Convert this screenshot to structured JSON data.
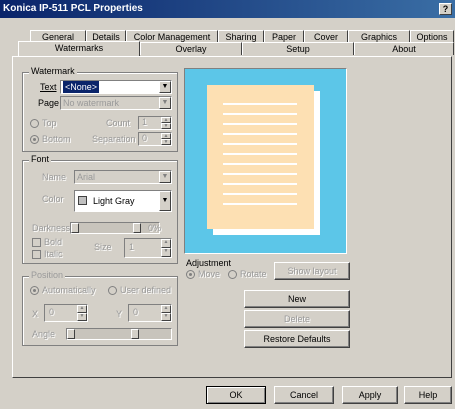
{
  "window": {
    "title": "Konica IP-511 PCL Properties",
    "help_button": "?"
  },
  "tabs_row1": [
    "General",
    "Details",
    "Color Management",
    "Sharing",
    "Paper",
    "Cover",
    "Graphics",
    "Options"
  ],
  "tabs_row2": [
    "Watermarks",
    "Overlay",
    "Setup",
    "About"
  ],
  "watermark": {
    "group_label": "Watermark",
    "text_label": "Text",
    "text_value": "<None>",
    "page_label": "Page",
    "page_value": "No watermark",
    "top_label": "Top",
    "bottom_label": "Bottom",
    "count_label": "Count",
    "count_value": "1",
    "separation_label": "Separation",
    "separation_value": "0"
  },
  "font": {
    "group_label": "Font",
    "name_label": "Name",
    "name_value": "Arial",
    "color_label": "Color",
    "color_value": "Light Gray",
    "darkness_label": "Darkness",
    "darkness_value": "0%",
    "bold_label": "Bold",
    "italic_label": "Italic",
    "size_label": "Size",
    "size_value": "1"
  },
  "position": {
    "group_label": "Position",
    "automatically_label": "Automatically",
    "user_defined_label": "User defined",
    "x_label": "X",
    "x_value": "0",
    "y_label": "Y",
    "y_value": "0",
    "angle_label": "Angle"
  },
  "adjustment": {
    "label": "Adjustment",
    "move_label": "Move",
    "rotate_label": "Rotate",
    "show_layout_button": "Show layout"
  },
  "actions": {
    "new": "New",
    "delete": "Delete",
    "restore_defaults": "Restore Defaults"
  },
  "footer": {
    "ok": "OK",
    "cancel": "Cancel",
    "apply": "Apply",
    "help": "Help"
  },
  "colors": {
    "title_bar": "#0a246a",
    "preview_background": "#5cc6e8",
    "page": "#fde0b3",
    "face": "#d4d0c8"
  }
}
